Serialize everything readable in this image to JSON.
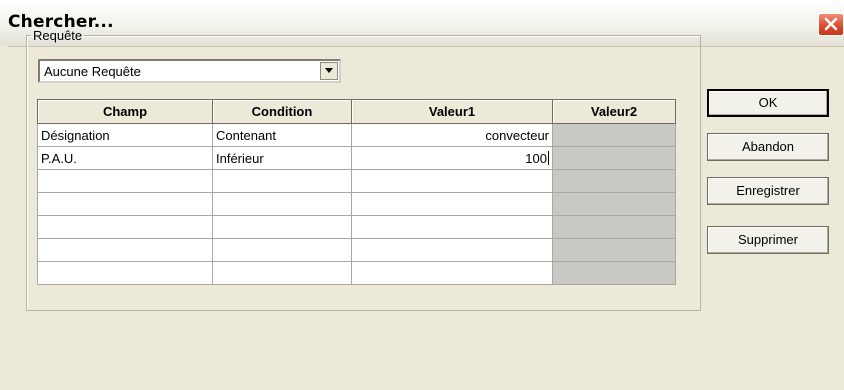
{
  "window": {
    "title": "Chercher..."
  },
  "query_group": {
    "legend": "Requête",
    "selected_query": "Aucune Requête"
  },
  "grid": {
    "columns": [
      "Champ",
      "Condition",
      "Valeur1",
      "Valeur2"
    ],
    "rows": [
      {
        "champ": "Désignation",
        "condition": "Contenant",
        "valeur1": "convecteur",
        "valeur2": ""
      },
      {
        "champ": "P.A.U.",
        "condition": "Inférieur",
        "valeur1": "100",
        "valeur2": ""
      },
      {
        "champ": "",
        "condition": "",
        "valeur1": "",
        "valeur2": ""
      },
      {
        "champ": "",
        "condition": "",
        "valeur1": "",
        "valeur2": ""
      },
      {
        "champ": "",
        "condition": "",
        "valeur1": "",
        "valeur2": ""
      },
      {
        "champ": "",
        "condition": "",
        "valeur1": "",
        "valeur2": ""
      },
      {
        "champ": "",
        "condition": "",
        "valeur1": "",
        "valeur2": ""
      }
    ]
  },
  "buttons": {
    "ok": "OK",
    "cancel": "Abandon",
    "save": "Enregistrer",
    "delete": "Supprimer"
  },
  "colors": {
    "dialog_background": "#ece9d8",
    "close_button": "#d9492b",
    "disabled_column": "#c8c8c5"
  },
  "icons": {
    "close": "close-x-icon",
    "dropdown": "triangle-down-icon"
  }
}
